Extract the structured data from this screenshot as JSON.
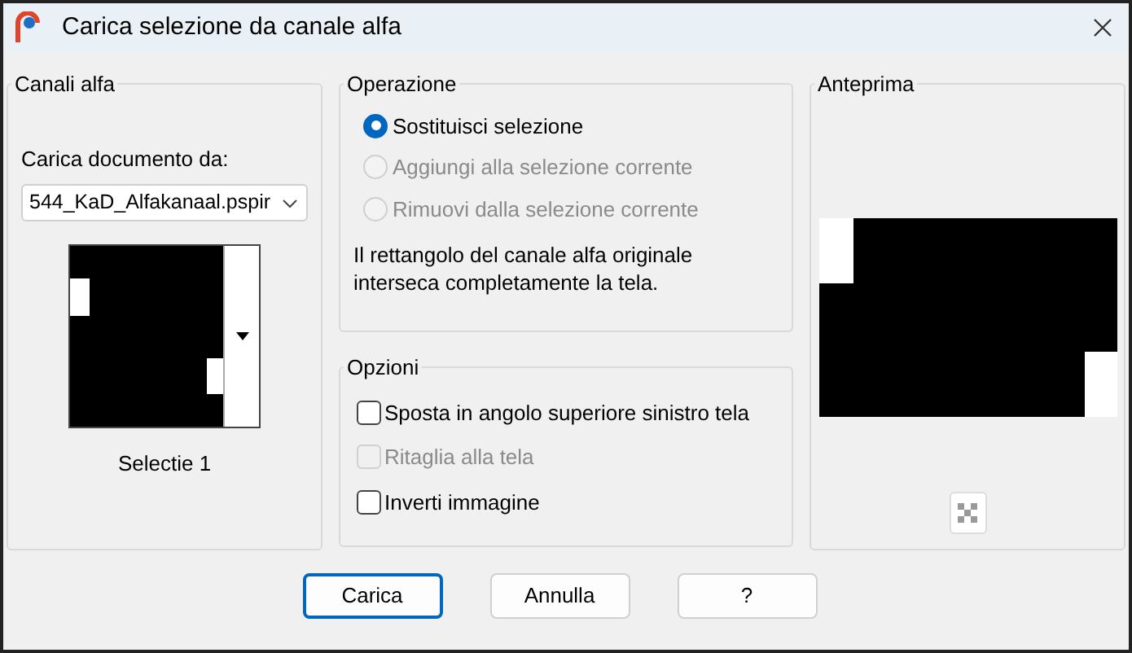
{
  "window": {
    "title": "Carica selezione da canale alfa"
  },
  "alpha_channels": {
    "title": "Canali alfa",
    "load_label": "Carica documento da:",
    "document": "544_KaD_Alfakanaal.pspir",
    "selection_name": "Selectie 1"
  },
  "operation": {
    "title": "Operazione",
    "choices": [
      {
        "label": "Sostituisci selezione",
        "selected": true,
        "disabled": false
      },
      {
        "label": "Aggiungi alla selezione corrente",
        "selected": false,
        "disabled": true
      },
      {
        "label": "Rimuovi dalla selezione corrente",
        "selected": false,
        "disabled": true
      }
    ],
    "note": "Il rettangolo del canale alfa originale interseca completamente la tela."
  },
  "options": {
    "title": "Opzioni",
    "items": [
      {
        "label": "Sposta in angolo superiore sinistro tela",
        "checked": false,
        "disabled": false
      },
      {
        "label": "Ritaglia alla tela",
        "checked": false,
        "disabled": true
      },
      {
        "label": "Inverti immagine",
        "checked": false,
        "disabled": false
      }
    ]
  },
  "preview": {
    "title": "Anteprima"
  },
  "buttons": [
    {
      "label": "Carica",
      "default": true
    },
    {
      "label": "Annulla",
      "default": false
    },
    {
      "label": "?",
      "default": false
    }
  ]
}
